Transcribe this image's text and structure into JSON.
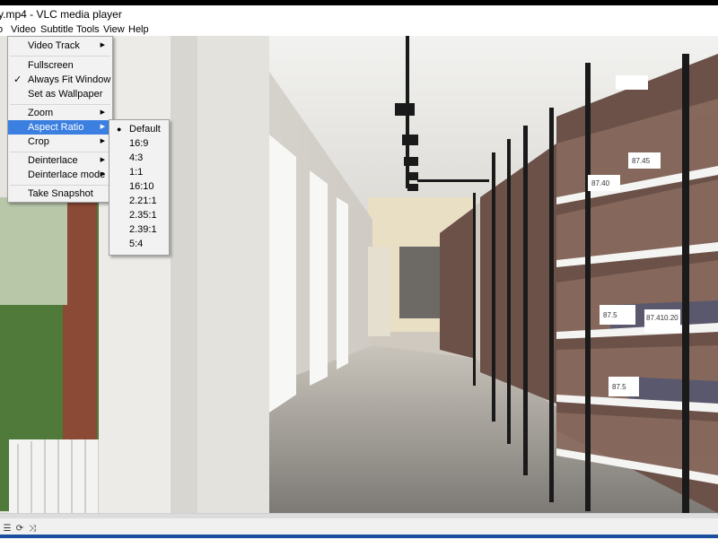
{
  "window": {
    "title": "y.mp4 - VLC media player"
  },
  "menubar": [
    {
      "label": "o"
    },
    {
      "label": "Video"
    },
    {
      "label": "Subtitle"
    },
    {
      "label": "Tools"
    },
    {
      "label": "View"
    },
    {
      "label": "Help"
    }
  ],
  "video_menu": {
    "items": [
      {
        "label": "Video Track",
        "submenu": true,
        "checked": false
      },
      {
        "label": "Fullscreen",
        "submenu": false,
        "checked": false
      },
      {
        "label": "Always Fit Window",
        "submenu": false,
        "checked": true
      },
      {
        "label": "Set as Wallpaper",
        "submenu": false,
        "checked": false
      },
      {
        "label": "Zoom",
        "submenu": true,
        "checked": false
      },
      {
        "label": "Aspect Ratio",
        "submenu": true,
        "checked": false,
        "highlighted": true
      },
      {
        "label": "Crop",
        "submenu": true,
        "checked": false
      },
      {
        "label": "Deinterlace",
        "submenu": true,
        "checked": false
      },
      {
        "label": "Deinterlace mode",
        "submenu": true,
        "checked": false
      },
      {
        "label": "Take Snapshot",
        "submenu": false,
        "checked": false
      }
    ]
  },
  "aspect_ratio_menu": {
    "options": [
      "Default",
      "16:9",
      "4:3",
      "1:1",
      "16:10",
      "2.21:1",
      "2.35:1",
      "2.39:1",
      "5:4"
    ],
    "selected": "Default"
  },
  "video_frame": {
    "labels": [
      "87.5",
      "87.410.20",
      "87.40",
      "87.45",
      "87.5"
    ]
  },
  "controls": {
    "icons": [
      "playlist-icon",
      "loop-icon",
      "shuffle-icon"
    ]
  },
  "colors": {
    "menu_highlight": "#3b7fe0",
    "menu_bg": "#f2f2f2",
    "shelf_black": "#1a1a1a"
  }
}
